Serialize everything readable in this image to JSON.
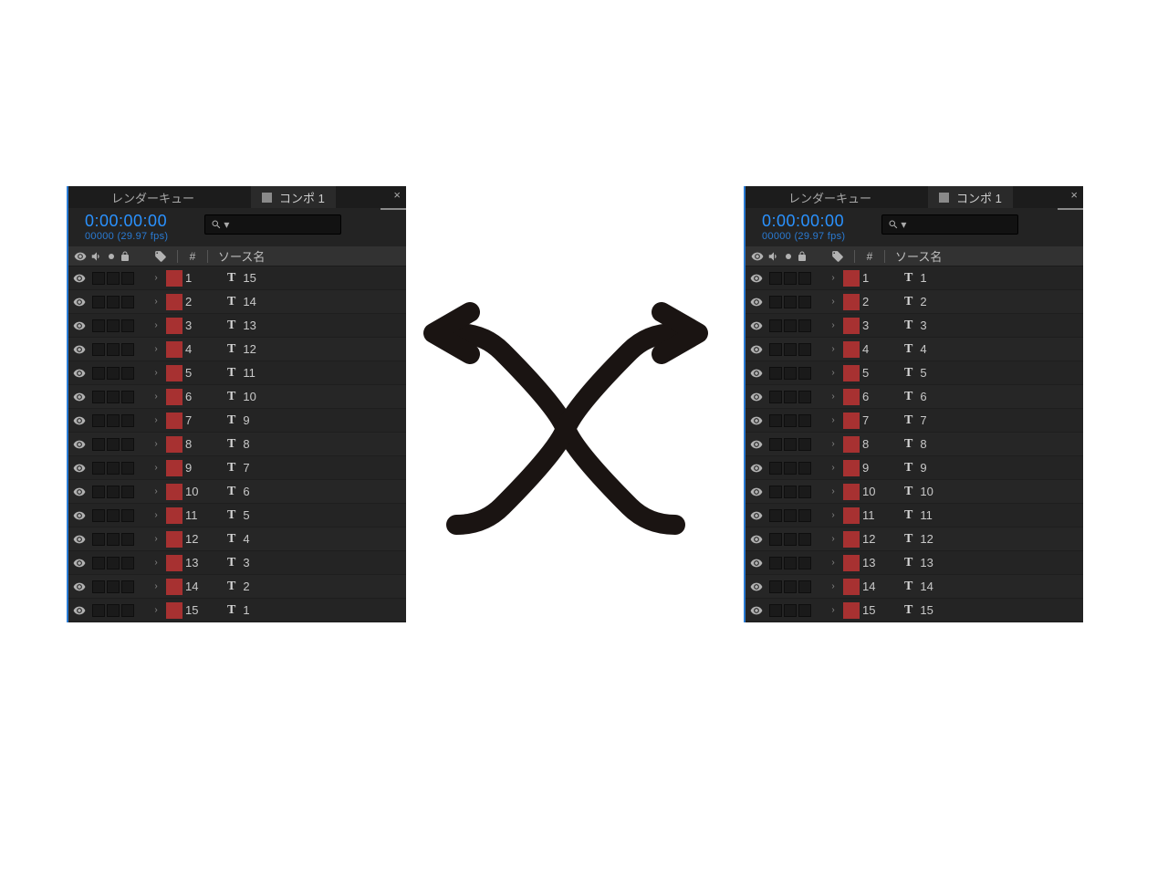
{
  "tabs": {
    "render_queue_label": "レンダーキュー",
    "comp_label": "コンポ 1",
    "close_label": "×"
  },
  "timecode": "0:00:00:00",
  "frameinfo": "00000 (29.97 fps)",
  "search": {
    "icon_text": "⌕",
    "placeholder": ""
  },
  "columns": {
    "hash": "#",
    "source_name": "ソース名"
  },
  "layer_color": "#a73131",
  "type_marker": "T",
  "panels": {
    "left": {
      "layers": [
        {
          "index": "1",
          "name": "15"
        },
        {
          "index": "2",
          "name": "14"
        },
        {
          "index": "3",
          "name": "13"
        },
        {
          "index": "4",
          "name": "12"
        },
        {
          "index": "5",
          "name": "11"
        },
        {
          "index": "6",
          "name": "10"
        },
        {
          "index": "7",
          "name": "9"
        },
        {
          "index": "8",
          "name": "8"
        },
        {
          "index": "9",
          "name": "7"
        },
        {
          "index": "10",
          "name": "6"
        },
        {
          "index": "11",
          "name": "5"
        },
        {
          "index": "12",
          "name": "4"
        },
        {
          "index": "13",
          "name": "3"
        },
        {
          "index": "14",
          "name": "2"
        },
        {
          "index": "15",
          "name": "1"
        }
      ]
    },
    "right": {
      "layers": [
        {
          "index": "1",
          "name": "1"
        },
        {
          "index": "2",
          "name": "2"
        },
        {
          "index": "3",
          "name": "3"
        },
        {
          "index": "4",
          "name": "4"
        },
        {
          "index": "5",
          "name": "5"
        },
        {
          "index": "6",
          "name": "6"
        },
        {
          "index": "7",
          "name": "7"
        },
        {
          "index": "8",
          "name": "8"
        },
        {
          "index": "9",
          "name": "9"
        },
        {
          "index": "10",
          "name": "10"
        },
        {
          "index": "11",
          "name": "11"
        },
        {
          "index": "12",
          "name": "12"
        },
        {
          "index": "13",
          "name": "13"
        },
        {
          "index": "14",
          "name": "14"
        },
        {
          "index": "15",
          "name": "15"
        }
      ]
    }
  }
}
